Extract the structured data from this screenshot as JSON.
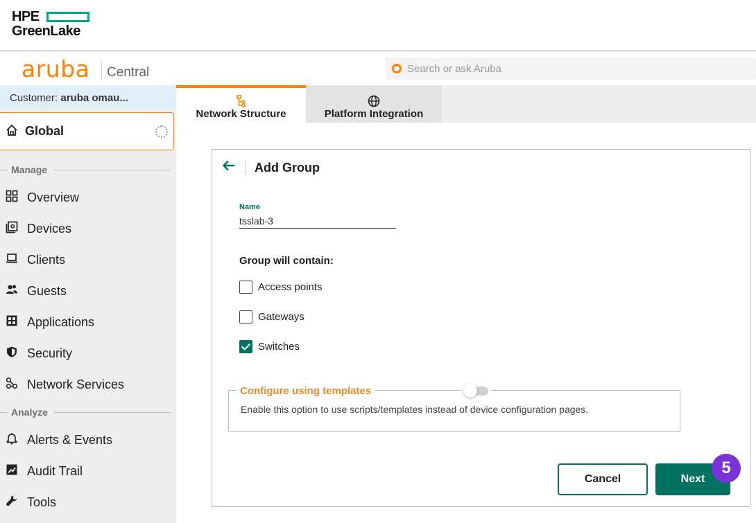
{
  "hpe": {
    "line1": "HPE",
    "line2": "GreenLake",
    "accent": "#01a982"
  },
  "aruba": {
    "brand": "aruba",
    "product": "Central",
    "accent": "#ff8300"
  },
  "search": {
    "placeholder": "Search or ask Aruba"
  },
  "sidebar": {
    "customer_prefix": "Customer:",
    "customer_name": "aruba omau...",
    "scope": "Global",
    "sections": {
      "manage": "Manage",
      "analyze": "Analyze"
    },
    "items": [
      {
        "label": "Overview",
        "icon": "grid-icon"
      },
      {
        "label": "Devices",
        "icon": "devices-icon"
      },
      {
        "label": "Clients",
        "icon": "laptop-icon"
      },
      {
        "label": "Guests",
        "icon": "people-icon"
      },
      {
        "label": "Applications",
        "icon": "apps-icon"
      },
      {
        "label": "Security",
        "icon": "shield-icon"
      },
      {
        "label": "Network Services",
        "icon": "network-icon"
      },
      {
        "label": "Alerts & Events",
        "icon": "bell-icon"
      },
      {
        "label": "Audit Trail",
        "icon": "audit-icon"
      },
      {
        "label": "Tools",
        "icon": "wrench-icon"
      }
    ]
  },
  "tabs": [
    {
      "label": "Network Structure",
      "icon": "hierarchy-icon",
      "active": true
    },
    {
      "label": "Platform Integration",
      "icon": "globe-icon",
      "active": false
    }
  ],
  "form": {
    "title": "Add Group",
    "name_label": "Name",
    "name_value": "tsslab-3",
    "contain_label": "Group will contain:",
    "options": [
      {
        "label": "Access points",
        "checked": false
      },
      {
        "label": "Gateways",
        "checked": false
      },
      {
        "label": "Switches",
        "checked": true
      }
    ],
    "templates_title": "Configure using templates",
    "templates_desc": "Enable this option to use scripts/templates instead of device configuration pages.",
    "templates_enabled": false,
    "cancel_label": "Cancel",
    "next_label": "Next",
    "step_badge": "5"
  }
}
